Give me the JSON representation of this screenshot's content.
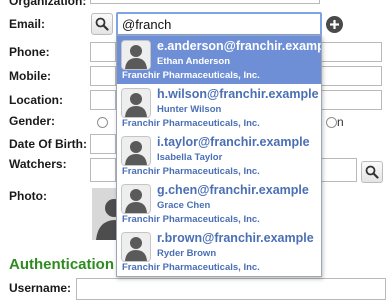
{
  "form": {
    "organization_label": "Organization:",
    "email_label": "Email:",
    "email_value": "@franch",
    "phone_label": "Phone:",
    "mobile_label": "Mobile:",
    "location_label": "Location:",
    "gender_label": "Gender:",
    "gender_fragment": "n",
    "dob_label": "Date Of Birth:",
    "watchers_label": "Watchers:",
    "photo_label": "Photo:",
    "authentication_title": "Authentication",
    "username_label": "Username:"
  },
  "icons": {
    "email_search": "search-icon",
    "email_add": "plus-icon",
    "watchers_search": "search-icon"
  },
  "colors": {
    "selected_bg": "#6e8fd6",
    "suggestion_text": "#4a6fb5",
    "section_title": "#2e8b1f"
  },
  "suggestions": [
    {
      "email": "e.anderson@franchir.example",
      "name": "Ethan Anderson",
      "company": "Franchir Pharmaceuticals, Inc.",
      "selected": true
    },
    {
      "email": "h.wilson@franchir.example",
      "name": "Hunter Wilson",
      "company": "Franchir Pharmaceuticals, Inc.",
      "selected": false
    },
    {
      "email": "i.taylor@franchir.example",
      "name": "Isabella Taylor",
      "company": "Franchir Pharmaceuticals, Inc.",
      "selected": false
    },
    {
      "email": "g.chen@franchir.example",
      "name": "Grace Chen",
      "company": "Franchir Pharmaceuticals, Inc.",
      "selected": false
    },
    {
      "email": "r.brown@franchir.example",
      "name": "Ryder Brown",
      "company": "Franchir Pharmaceuticals, Inc.",
      "selected": false
    }
  ]
}
